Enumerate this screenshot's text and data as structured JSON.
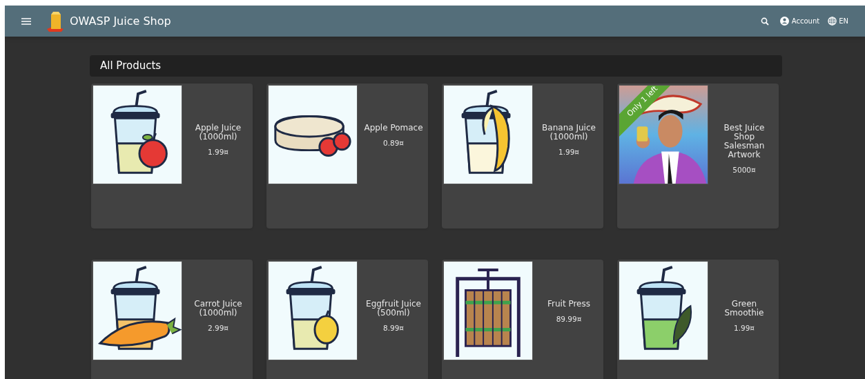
{
  "toolbar": {
    "title": "OWASP Juice Shop",
    "account": "Account",
    "language": "EN"
  },
  "heading": "All Products",
  "products": [
    {
      "name": "Apple Juice (1000ml)",
      "price": "1.99¤",
      "kind": "apple"
    },
    {
      "name": "Apple Pomace",
      "price": "0.89¤",
      "kind": "pomace"
    },
    {
      "name": "Banana Juice (1000ml)",
      "price": "1.99¤",
      "kind": "banana"
    },
    {
      "name": "Best Juice Shop Salesman Artwork",
      "price": "5000¤",
      "kind": "artwork",
      "badge": "Only 1 left"
    },
    {
      "name": "Carrot Juice (1000ml)",
      "price": "2.99¤",
      "kind": "carrot"
    },
    {
      "name": "Eggfruit Juice (500ml)",
      "price": "8.99¤",
      "kind": "eggfruit"
    },
    {
      "name": "Fruit Press",
      "price": "89.99¤",
      "kind": "press"
    },
    {
      "name": "Green Smoothie",
      "price": "1.99¤",
      "kind": "smoothie"
    }
  ]
}
